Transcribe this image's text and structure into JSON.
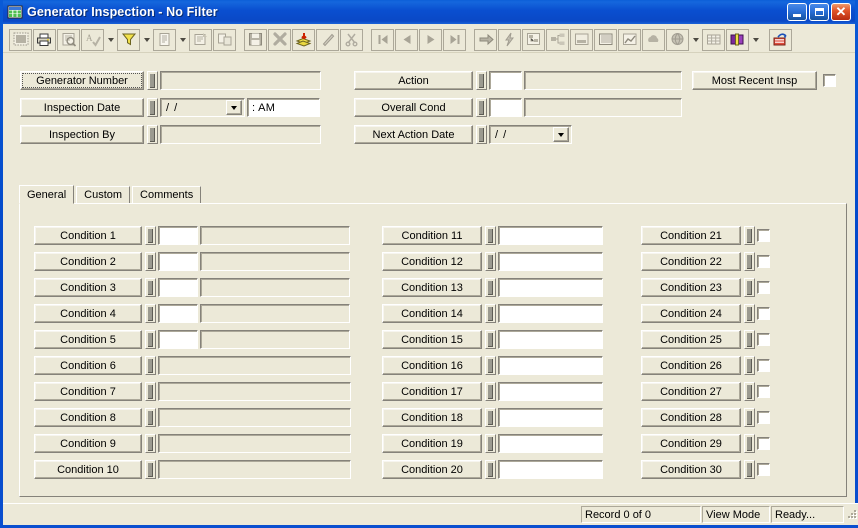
{
  "window": {
    "title": "Generator Inspection - No Filter",
    "icon": "grid-table-icon",
    "controls": {
      "minimize": "Minimize",
      "maximize": "Maximize",
      "close": "Close"
    },
    "colors": {
      "titlebar": "#0a4fd0",
      "face": "#ece9d8",
      "close": "#e2552a"
    }
  },
  "toolbar": {
    "groups": [
      {
        "buttons": [
          {
            "name": "design-view-icon",
            "label": "Design View",
            "framed": true,
            "dropdown": false,
            "enabled": true
          },
          {
            "name": "print-icon",
            "label": "Print",
            "framed": true,
            "dropdown": false,
            "enabled": true
          },
          {
            "name": "print-preview-icon",
            "label": "Print Preview",
            "framed": true,
            "dropdown": false,
            "enabled": false
          },
          {
            "name": "spell-check-icon",
            "label": "Spelling",
            "framed": true,
            "dropdown": true,
            "enabled": false
          },
          {
            "name": "filter-icon",
            "label": "Filter By Form",
            "framed": true,
            "dropdown": true,
            "enabled": true
          },
          {
            "name": "new-record-icon",
            "label": "New Record",
            "framed": true,
            "dropdown": true,
            "enabled": false
          },
          {
            "name": "properties-icon",
            "label": "Properties",
            "framed": true,
            "dropdown": false,
            "enabled": false
          },
          {
            "name": "relationships-icon",
            "label": "Relationships",
            "framed": true,
            "dropdown": false,
            "enabled": false
          }
        ]
      },
      {
        "buttons": [
          {
            "name": "save-icon",
            "label": "Save",
            "framed": true,
            "dropdown": false,
            "enabled": false
          },
          {
            "name": "delete-icon",
            "label": "Delete Record",
            "framed": true,
            "dropdown": false,
            "enabled": false
          },
          {
            "name": "copy-record-icon",
            "label": "Copy Record",
            "framed": true,
            "dropdown": false,
            "enabled": true
          },
          {
            "name": "edit-pencil-icon",
            "label": "Edit",
            "framed": true,
            "dropdown": false,
            "enabled": false
          },
          {
            "name": "cut-scissors-icon",
            "label": "Cut",
            "framed": true,
            "dropdown": false,
            "enabled": false
          }
        ]
      },
      {
        "buttons": [
          {
            "name": "first-record-icon",
            "label": "First Record",
            "framed": true,
            "dropdown": false,
            "enabled": false
          },
          {
            "name": "previous-record-icon",
            "label": "Previous Record",
            "framed": true,
            "dropdown": false,
            "enabled": false
          },
          {
            "name": "next-record-icon",
            "label": "Next Record",
            "framed": true,
            "dropdown": false,
            "enabled": false
          },
          {
            "name": "last-record-icon",
            "label": "Last Record",
            "framed": true,
            "dropdown": false,
            "enabled": false
          }
        ]
      },
      {
        "buttons": [
          {
            "name": "goto-record-icon",
            "label": "Go To Record",
            "framed": true,
            "dropdown": false,
            "enabled": true
          },
          {
            "name": "lightning-icon",
            "label": "Run Query",
            "framed": true,
            "dropdown": false,
            "enabled": false
          },
          {
            "name": "hierarchy-icon",
            "label": "Subform Tree",
            "framed": true,
            "dropdown": false,
            "enabled": false
          },
          {
            "name": "org-chart-icon",
            "label": "Structure",
            "framed": true,
            "dropdown": false,
            "enabled": false
          },
          {
            "name": "form-view-icon",
            "label": "Form View",
            "framed": true,
            "dropdown": false,
            "enabled": false
          },
          {
            "name": "report-icon",
            "label": "Report",
            "framed": true,
            "dropdown": false,
            "enabled": false
          },
          {
            "name": "chart-icon",
            "label": "Chart",
            "framed": true,
            "dropdown": false,
            "enabled": false
          },
          {
            "name": "cloud-icon",
            "label": "Notes",
            "framed": true,
            "dropdown": false,
            "enabled": false
          },
          {
            "name": "search-globe-icon",
            "label": "Search",
            "framed": true,
            "dropdown": true,
            "enabled": false
          },
          {
            "name": "grid-icon",
            "label": "Datasheet",
            "framed": true,
            "dropdown": false,
            "enabled": false
          },
          {
            "name": "help-book-icon",
            "label": "Help",
            "framed": true,
            "dropdown": true,
            "enabled": true
          }
        ]
      },
      {
        "buttons": [
          {
            "name": "export-icon",
            "label": "Export",
            "framed": true,
            "dropdown": false,
            "enabled": true
          }
        ]
      }
    ]
  },
  "header": {
    "left_fields": [
      {
        "name": "generator-number",
        "label": "Generator Number",
        "value": "",
        "placeholder": "",
        "type": "text",
        "focused": true
      },
      {
        "name": "inspection-date",
        "label": "Inspection Date",
        "value": "/  /",
        "time_value": ":    AM",
        "type": "date"
      },
      {
        "name": "inspection-by",
        "label": "Inspection By",
        "value": "",
        "placeholder": "",
        "type": "text"
      }
    ],
    "middle_fields": [
      {
        "name": "action",
        "label": "Action",
        "code_value": "",
        "desc_value": "",
        "type": "code-desc"
      },
      {
        "name": "overall-cond",
        "label": "Overall Cond",
        "code_value": "",
        "desc_value": "",
        "type": "code-desc"
      },
      {
        "name": "next-action-date",
        "label": "Next Action Date",
        "value": "/  /",
        "type": "date"
      }
    ],
    "right": {
      "name": "most-recent-insp",
      "label": "Most Recent Insp",
      "checked": false
    }
  },
  "tabs": [
    {
      "name": "tab-general",
      "label": "General",
      "active": true
    },
    {
      "name": "tab-custom",
      "label": "Custom",
      "active": false
    },
    {
      "name": "tab-comments",
      "label": "Comments",
      "active": false
    }
  ],
  "conditions": {
    "column1": [
      {
        "label": "Condition 1",
        "type": "code-desc",
        "code_value": "",
        "desc_value": ""
      },
      {
        "label": "Condition 2",
        "type": "code-desc",
        "code_value": "",
        "desc_value": ""
      },
      {
        "label": "Condition 3",
        "type": "code-desc",
        "code_value": "",
        "desc_value": ""
      },
      {
        "label": "Condition 4",
        "type": "code-desc",
        "code_value": "",
        "desc_value": ""
      },
      {
        "label": "Condition 5",
        "type": "code-desc",
        "code_value": "",
        "desc_value": ""
      },
      {
        "label": "Condition 6",
        "type": "wide",
        "value": ""
      },
      {
        "label": "Condition 7",
        "type": "wide",
        "value": ""
      },
      {
        "label": "Condition 8",
        "type": "wide",
        "value": ""
      },
      {
        "label": "Condition 9",
        "type": "wide",
        "value": ""
      },
      {
        "label": "Condition 10",
        "type": "wide",
        "value": ""
      }
    ],
    "column2": [
      {
        "label": "Condition 11",
        "type": "wide",
        "value": ""
      },
      {
        "label": "Condition 12",
        "type": "wide",
        "value": ""
      },
      {
        "label": "Condition 13",
        "type": "wide",
        "value": ""
      },
      {
        "label": "Condition 14",
        "type": "wide",
        "value": ""
      },
      {
        "label": "Condition 15",
        "type": "wide",
        "value": ""
      },
      {
        "label": "Condition 16",
        "type": "wide",
        "value": ""
      },
      {
        "label": "Condition 17",
        "type": "wide",
        "value": ""
      },
      {
        "label": "Condition 18",
        "type": "wide",
        "value": ""
      },
      {
        "label": "Condition 19",
        "type": "wide",
        "value": ""
      },
      {
        "label": "Condition 20",
        "type": "wide",
        "value": ""
      }
    ],
    "column3": [
      {
        "label": "Condition 21",
        "type": "checkbox",
        "checked": false
      },
      {
        "label": "Condition 22",
        "type": "checkbox",
        "checked": false
      },
      {
        "label": "Condition 23",
        "type": "checkbox",
        "checked": false
      },
      {
        "label": "Condition 24",
        "type": "checkbox",
        "checked": false
      },
      {
        "label": "Condition 25",
        "type": "checkbox",
        "checked": false
      },
      {
        "label": "Condition 26",
        "type": "checkbox",
        "checked": false
      },
      {
        "label": "Condition 27",
        "type": "checkbox",
        "checked": false
      },
      {
        "label": "Condition 28",
        "type": "checkbox",
        "checked": false
      },
      {
        "label": "Condition 29",
        "type": "checkbox",
        "checked": false
      },
      {
        "label": "Condition 30",
        "type": "checkbox",
        "checked": false
      }
    ]
  },
  "statusbar": {
    "record": "Record 0 of 0",
    "mode": "View Mode",
    "state": "Ready..."
  }
}
